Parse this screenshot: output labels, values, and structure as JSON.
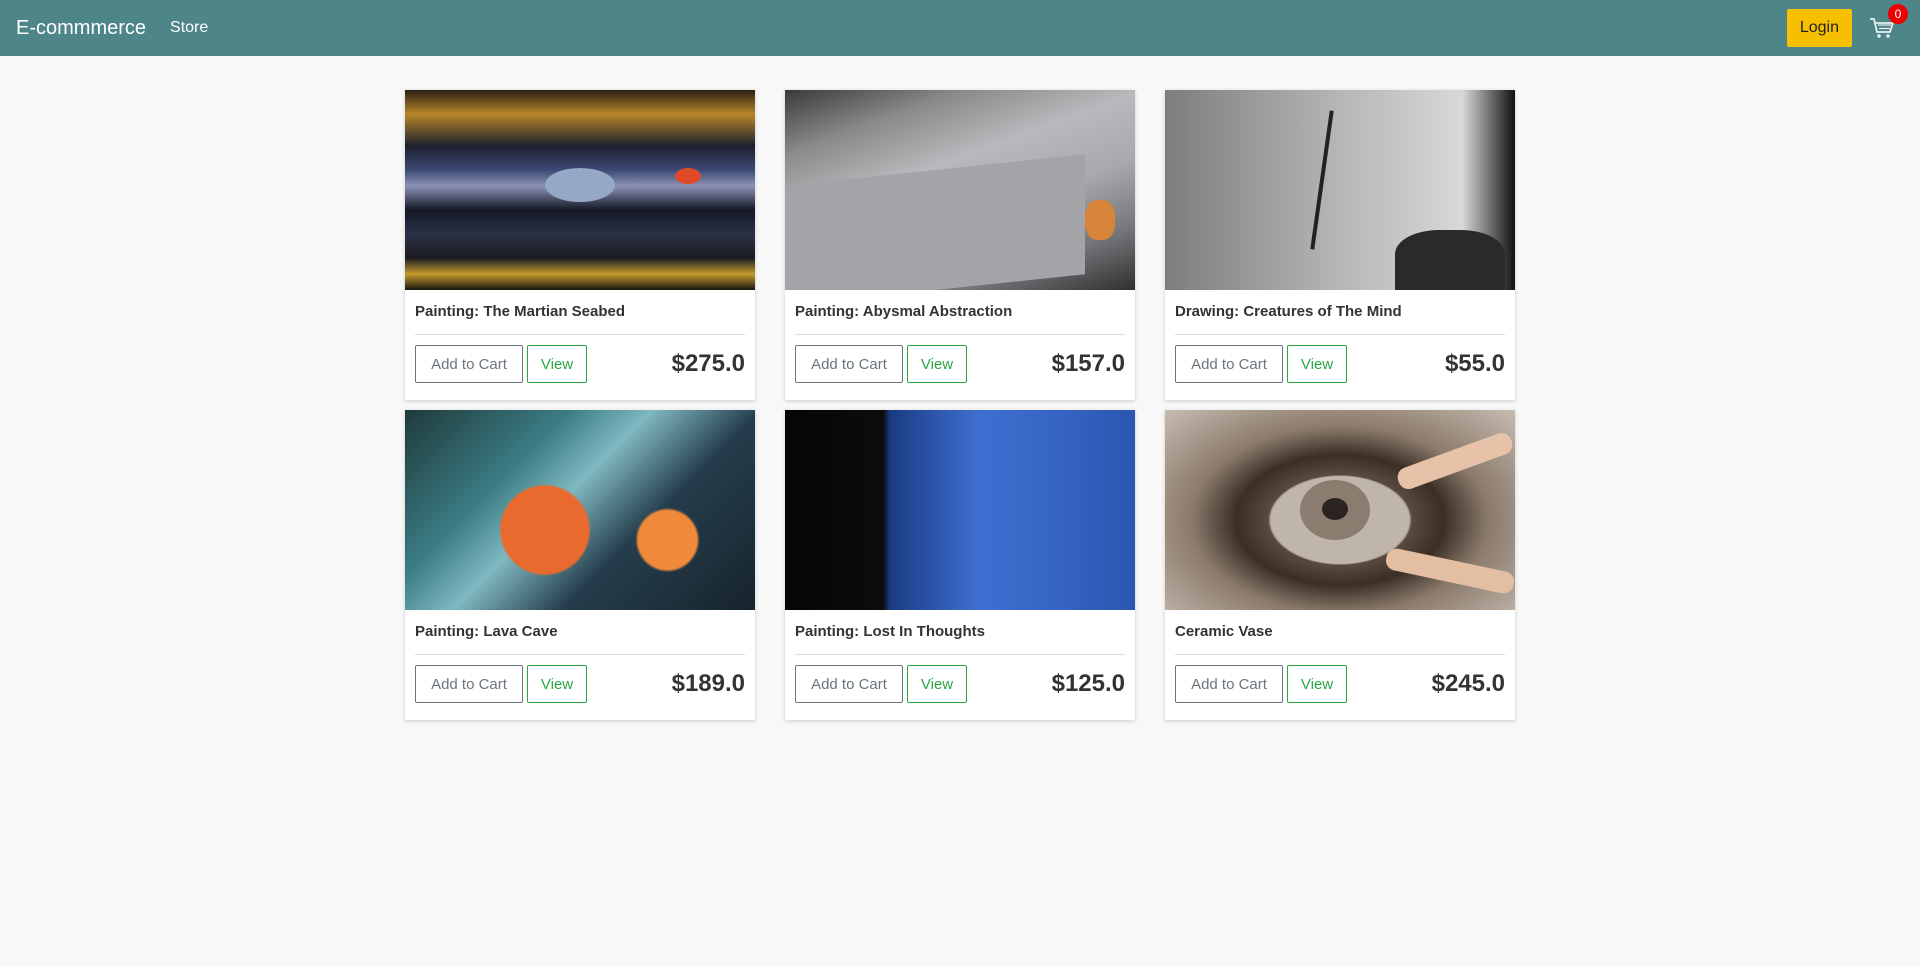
{
  "navbar": {
    "brand": "E-commmerce",
    "store_link": "Store",
    "login_label": "Login",
    "cart_icon": "cart-icon",
    "cart_count": "0"
  },
  "products": [
    {
      "title": "Painting: The Martian Seabed",
      "price": "$275.0",
      "add_label": "Add to Cart",
      "view_label": "View"
    },
    {
      "title": "Painting: Abysmal Abstraction",
      "price": "$157.0",
      "add_label": "Add to Cart",
      "view_label": "View"
    },
    {
      "title": "Drawing: Creatures of The Mind",
      "price": "$55.0",
      "add_label": "Add to Cart",
      "view_label": "View"
    },
    {
      "title": "Painting: Lava Cave",
      "price": "$189.0",
      "add_label": "Add to Cart",
      "view_label": "View"
    },
    {
      "title": "Painting: Lost In Thoughts",
      "price": "$125.0",
      "add_label": "Add to Cart",
      "view_label": "View"
    },
    {
      "title": "Ceramic Vase",
      "price": "$245.0",
      "add_label": "Add to Cart",
      "view_label": "View"
    }
  ],
  "colors": {
    "navbar": "#4e8588",
    "login_button": "#f6c000",
    "badge": "#ee0000",
    "view_button": "#28a745",
    "cart_button": "#6c757d"
  }
}
